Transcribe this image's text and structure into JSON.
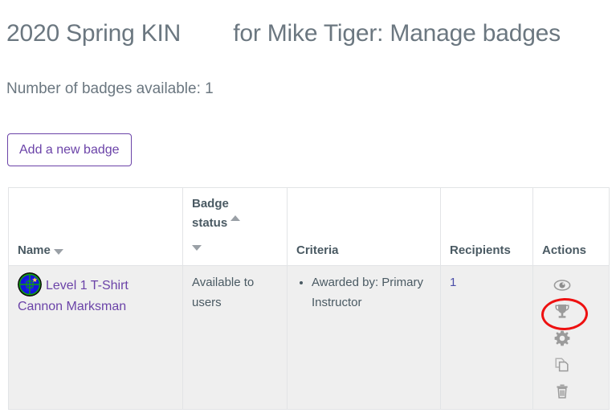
{
  "header": {
    "title": "2020 Spring KIN        for Mike Tiger: Manage badges",
    "badge_count_text": "Number of badges available: 1"
  },
  "toolbar": {
    "add_badge_label": "Add a new badge"
  },
  "table": {
    "columns": [
      {
        "label": "Name",
        "sort": "down",
        "name": "name"
      },
      {
        "label_line1": "Badge",
        "label_line2": "status",
        "sort": "both",
        "name": "badge-status"
      },
      {
        "label": "Criteria",
        "sort": "none",
        "name": "criteria"
      },
      {
        "label": "Recipients",
        "sort": "none",
        "name": "recipients"
      },
      {
        "label": "Actions",
        "sort": "none",
        "name": "actions"
      }
    ],
    "rows": [
      {
        "name": "Level 1 T-Shirt Cannon Marksman",
        "badge_status": "Available to users",
        "criteria": [
          "Awarded by: Primary Instructor"
        ],
        "recipients": "1",
        "actions": [
          {
            "icon": "eye-icon",
            "label": "preview"
          },
          {
            "icon": "trophy-icon",
            "label": "award",
            "annotated": true
          },
          {
            "icon": "gear-icon",
            "label": "settings"
          },
          {
            "icon": "copy-icon",
            "label": "duplicate"
          },
          {
            "icon": "trash-icon",
            "label": "delete"
          }
        ]
      }
    ]
  },
  "colors": {
    "link_purple": "#6b43a8",
    "heading_gray": "#6b7780",
    "row_background": "#efefef",
    "annotation_red": "#ee1111",
    "badge_blue": "#1414dd",
    "badge_green": "#0fa00f",
    "badge_star": "#ffd24a"
  }
}
